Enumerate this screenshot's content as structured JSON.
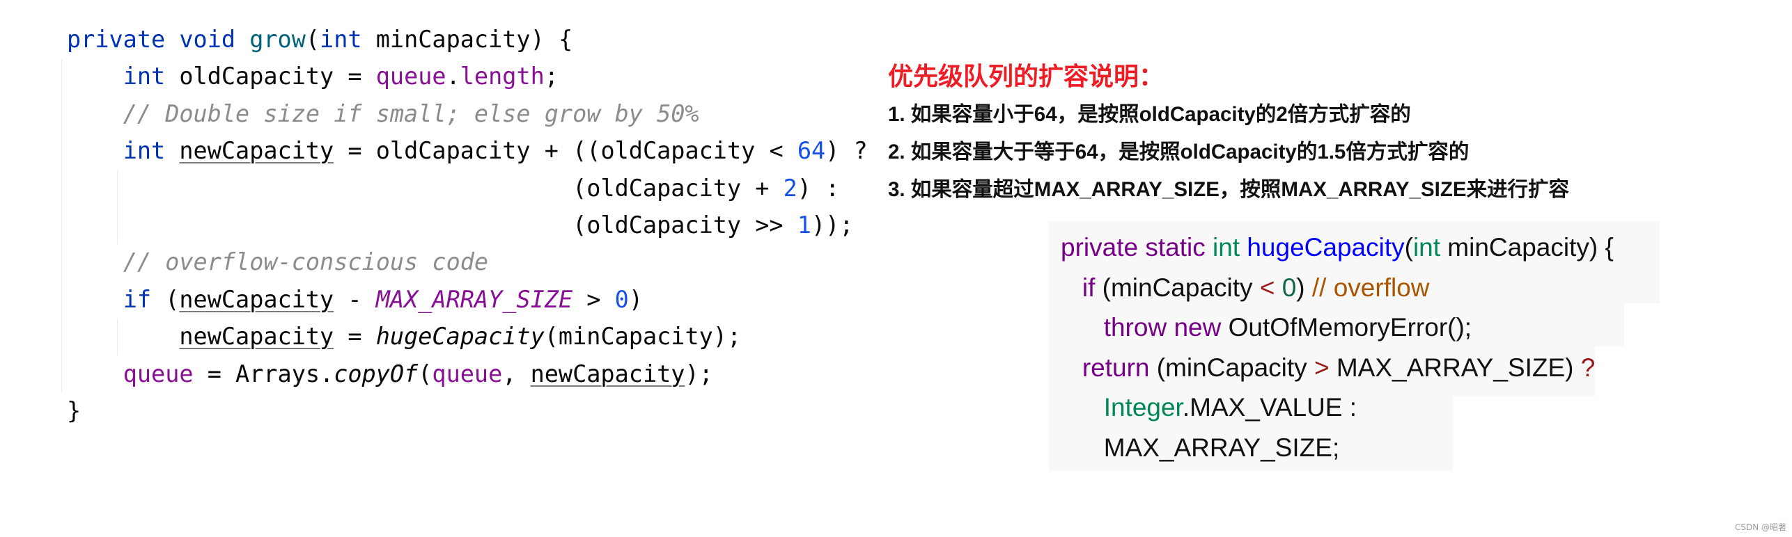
{
  "left_code": {
    "language": "java",
    "lines": [
      {
        "tokens": [
          [
            "kw",
            "private "
          ],
          [
            "kw",
            "void "
          ],
          [
            "fn",
            "grow"
          ],
          [
            "",
            "("
          ],
          [
            "kw",
            "int "
          ],
          [
            "",
            "minCapacity) {"
          ]
        ]
      },
      {
        "tokens": [
          [
            "",
            "    "
          ],
          [
            "kw",
            "int "
          ],
          [
            "",
            "oldCapacity = "
          ],
          [
            "fld",
            "queue"
          ],
          [
            "",
            "."
          ],
          [
            "fld",
            "length"
          ],
          [
            "",
            ";"
          ]
        ]
      },
      {
        "tokens": [
          [
            "",
            "    "
          ],
          [
            "cmt",
            "// Double size if small; else grow by 50%"
          ]
        ]
      },
      {
        "tokens": [
          [
            "",
            "    "
          ],
          [
            "kw",
            "int "
          ],
          [
            "ul",
            "newCapacity"
          ],
          [
            "",
            " = oldCapacity + ((oldCapacity < "
          ],
          [
            "num",
            "64"
          ],
          [
            "",
            ") ?"
          ]
        ]
      },
      {
        "tokens": [
          [
            "",
            "                                    (oldCapacity + "
          ],
          [
            "num",
            "2"
          ],
          [
            "",
            ") :"
          ]
        ]
      },
      {
        "tokens": [
          [
            "",
            "                                    (oldCapacity >> "
          ],
          [
            "num",
            "1"
          ],
          [
            "",
            "));"
          ]
        ]
      },
      {
        "tokens": [
          [
            "",
            "    "
          ],
          [
            "cmt",
            "// overflow-conscious code"
          ]
        ]
      },
      {
        "tokens": [
          [
            "",
            "    "
          ],
          [
            "kw",
            "if "
          ],
          [
            "",
            "("
          ],
          [
            "ul",
            "newCapacity"
          ],
          [
            "",
            " - "
          ],
          [
            "cst",
            "MAX_ARRAY_SIZE"
          ],
          [
            "",
            " > "
          ],
          [
            "num",
            "0"
          ],
          [
            "",
            ")"
          ]
        ]
      },
      {
        "tokens": [
          [
            "",
            "        "
          ],
          [
            "ul",
            "newCapacity"
          ],
          [
            "",
            " = "
          ],
          [
            "it",
            "hugeCapacity"
          ],
          [
            "",
            "(minCapacity);"
          ]
        ]
      },
      {
        "tokens": [
          [
            "",
            "    "
          ],
          [
            "fld",
            "queue"
          ],
          [
            "",
            " = Arrays."
          ],
          [
            "it",
            "copyOf"
          ],
          [
            "",
            "("
          ],
          [
            "fld",
            "queue"
          ],
          [
            "",
            ", "
          ],
          [
            "ul",
            "newCapacity"
          ],
          [
            "",
            ");"
          ]
        ]
      },
      {
        "tokens": [
          [
            "",
            "}"
          ]
        ]
      }
    ]
  },
  "notes": {
    "title": "优先级队列的扩容说明：",
    "items": [
      "1. 如果容量小于64，是按照oldCapacity的2倍方式扩容的",
      "2. 如果容量大于等于64，是按照oldCapacity的1.5倍方式扩容的",
      "3. 如果容量超过MAX_ARRAY_SIZE，按照MAX_ARRAY_SIZE来进行扩容"
    ]
  },
  "right_code": {
    "language": "java",
    "lines": [
      {
        "tokens": [
          [
            "s-kw",
            "private static "
          ],
          [
            "s-ty",
            "int "
          ],
          [
            "s-fn",
            "hugeCapacity"
          ],
          [
            "",
            "("
          ],
          [
            "s-ty",
            "int "
          ],
          [
            "",
            "minCapacity) {"
          ]
        ]
      },
      {
        "tokens": [
          [
            "",
            "   "
          ],
          [
            "s-kw",
            "if "
          ],
          [
            "",
            "(minCapacity "
          ],
          [
            "s-op",
            "<"
          ],
          [
            "",
            " "
          ],
          [
            "s-num",
            "0"
          ],
          [
            "",
            ") "
          ],
          [
            "s-cmt",
            "// overflow"
          ]
        ]
      },
      {
        "tokens": [
          [
            "",
            "      "
          ],
          [
            "s-kw",
            "throw new "
          ],
          [
            "",
            "OutOfMemoryError();"
          ]
        ]
      },
      {
        "tokens": [
          [
            "",
            "   "
          ],
          [
            "s-kw",
            "return "
          ],
          [
            "",
            "(minCapacity "
          ],
          [
            "s-op",
            ">"
          ],
          [
            "",
            " MAX_ARRAY_SIZE) "
          ],
          [
            "s-op",
            "?"
          ]
        ]
      },
      {
        "tokens": [
          [
            "",
            "      "
          ],
          [
            "s-ty",
            "Integer"
          ],
          [
            "",
            ".MAX_VALUE :"
          ]
        ]
      },
      {
        "tokens": [
          [
            "",
            "      "
          ],
          [
            "",
            "MAX_ARRAY_SIZE;"
          ]
        ]
      }
    ]
  },
  "watermark": "CSDN @昭著"
}
